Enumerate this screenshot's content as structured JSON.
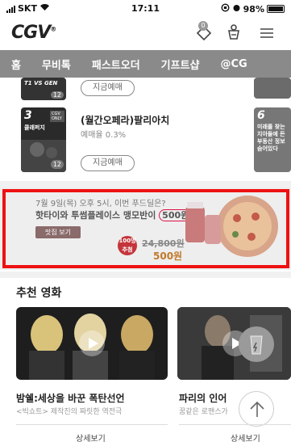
{
  "status_bar": {
    "carrier": "SKT",
    "time": "17:11",
    "battery": "98%",
    "battery_level": 0.98
  },
  "header": {
    "logo": "CGV",
    "logo_mark": "®",
    "notification_count": "0"
  },
  "nav": {
    "tabs": [
      {
        "label": "홈"
      },
      {
        "label": "무비톡"
      },
      {
        "label": "패스트오더"
      },
      {
        "label": "기프트샵"
      },
      {
        "label": "@CG"
      }
    ]
  },
  "movies": [
    {
      "rank": "",
      "poster_text": "T1 VS GEN",
      "age": "12",
      "ticket_label": "지금예매"
    },
    {
      "rank": "3",
      "poster_text": "클래퍼지",
      "poster_tag": "CGV ONLY",
      "age": "12",
      "title": "(월간오페라)팔리아치",
      "rate": "예매율 0.3%",
      "ticket_label": "지금예매"
    }
  ],
  "side_posters": [
    {
      "rank": "6",
      "text": "미래를 찾는 지아들에 든 부동산 정보 숨어있다"
    }
  ],
  "banner": {
    "line1": "7월 9일(목) 오후 5시, 이번 푸드딜은?",
    "line2_pre": "핫타이와 투썸플레이스 맹모반이 ",
    "line2_highlight": "500원",
    "line2_post": "!",
    "button": "맛집 보기",
    "sticker": "100명 추첨",
    "price_old": "24,800원",
    "price_new": "500원"
  },
  "recommended": {
    "title": "추천 영화",
    "items": [
      {
        "name": "밤쉘:세상을 바꾼 폭탄선언",
        "sub": "<빅쇼트> 제작진의 짜릿한 역전극",
        "detail": "상세보기"
      },
      {
        "name": "파리의 인어",
        "sub": "꿈같은 로맨스가",
        "detail": "상세보기"
      }
    ]
  },
  "colors": {
    "nav_bg": "#8a8a8a",
    "highlight_frame": "#ee1111",
    "banner_bg": "#eeeeee"
  }
}
